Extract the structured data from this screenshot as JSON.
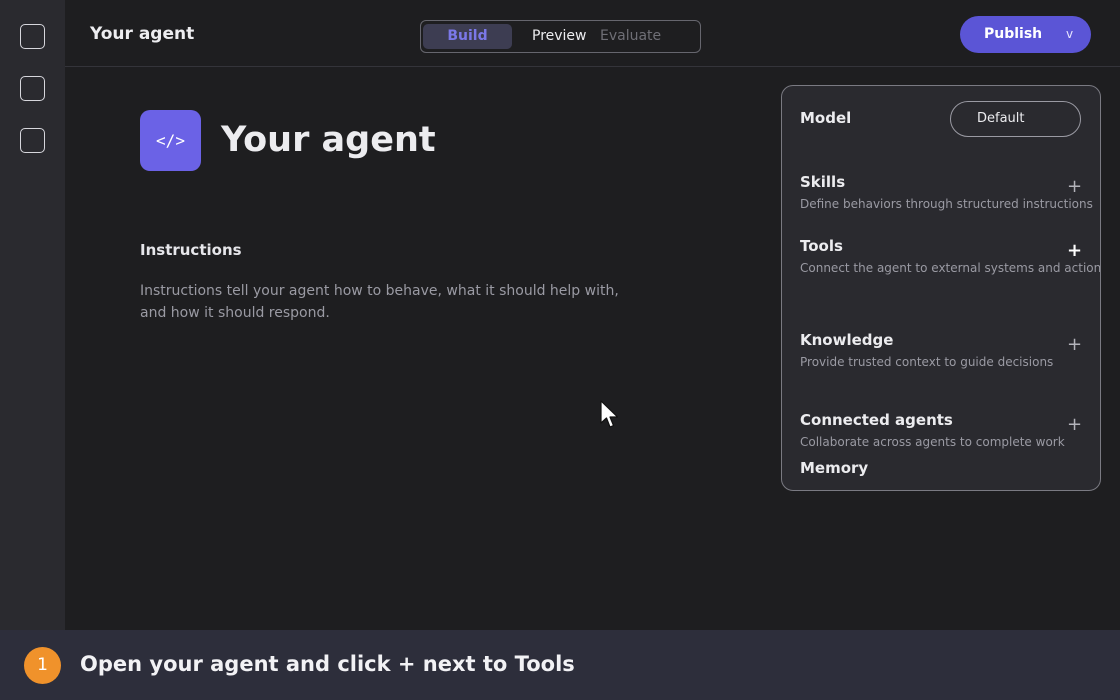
{
  "header": {
    "agent_title": "Your agent",
    "tabs": [
      {
        "label": "Build",
        "state": "active"
      },
      {
        "label": "Preview",
        "state": "normal"
      },
      {
        "label": "Evaluate",
        "state": "disabled"
      }
    ],
    "publish_label": "Publish",
    "publish_caret": "v"
  },
  "rail": {
    "items": [
      {
        "icon": "square-icon"
      },
      {
        "icon": "square-icon"
      },
      {
        "icon": "square-icon"
      }
    ]
  },
  "main": {
    "badge_glyph": "</>",
    "title": "Your agent",
    "instructions_heading": "Instructions",
    "instructions_placeholder": "Instructions tell your agent how to behave, what it should help with, and how it should respond."
  },
  "panel": {
    "model": {
      "label": "Model",
      "value": "Default"
    },
    "sections": [
      {
        "label": "Skills",
        "description": "Define behaviors through structured instructions",
        "action": "+"
      },
      {
        "label": "Tools",
        "description": "Connect the agent to external systems and actions",
        "action": "+"
      },
      {
        "label": "Knowledge",
        "description": "Provide trusted context to guide decisions",
        "action": "+"
      },
      {
        "label": "Connected agents",
        "description": "Collaborate across agents to complete work",
        "action": "+"
      },
      {
        "label": "Memory"
      }
    ]
  },
  "banner": {
    "step_number": "1",
    "instruction": "Open your agent and click + next to Tools"
  },
  "colors": {
    "accent": "#5b55d6",
    "badge": "#6b62e6",
    "step_badge": "#f0922b",
    "background": "#1e1e20",
    "panel": "#2a2a2f"
  }
}
